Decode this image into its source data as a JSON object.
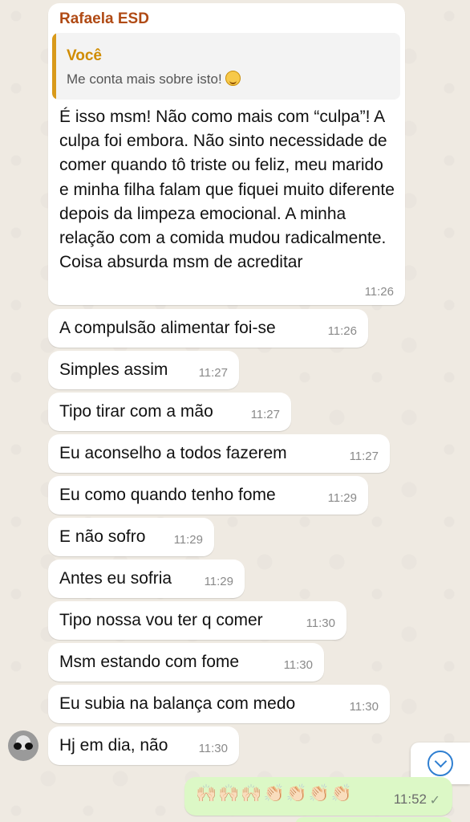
{
  "first_message": {
    "sender": "Rafaela ESD",
    "quote_author": "Você",
    "quote_text": "Me conta mais sobre isto!",
    "quote_emoji": "star-struck-emoji",
    "body": "É isso msm! Não como mais com “culpa”! A culpa foi embora. Não sinto necessidade de comer quando tô triste ou feliz, meu marido e minha filha falam que fiquei muito diferente depois da limpeza emocional. A minha relação com a comida mudou radicalmente. Coisa absurda msm de acreditar",
    "time": "11:26"
  },
  "messages": [
    {
      "text": "A compulsão alimentar foi-se",
      "time": "11:26"
    },
    {
      "text": "Simples assim",
      "time": "11:27"
    },
    {
      "text": "Tipo tirar com a mão",
      "time": "11:27"
    },
    {
      "text": "Eu aconselho a todos fazerem",
      "time": "11:27"
    },
    {
      "text": "Eu como quando tenho fome",
      "time": "11:29"
    },
    {
      "text": "E não sofro",
      "time": "11:29"
    },
    {
      "text": "Antes eu sofria",
      "time": "11:29"
    },
    {
      "text": "Tipo nossa vou ter q comer",
      "time": "11:30"
    },
    {
      "text": "Msm estando com fome",
      "time": "11:30"
    },
    {
      "text": "Eu subia na balança com medo",
      "time": "11:30"
    },
    {
      "text": "Hj em dia, não",
      "time": "11:30"
    }
  ],
  "outgoing": {
    "emojis": "🙌🏻🙌🏻🙌🏻👏🏻👏🏻👏🏻👏🏻",
    "time": "11:52",
    "status_icon": "delivered-check-icon"
  },
  "scroll_button_icon": "chevron-down-circle-icon",
  "colors": {
    "sender_name": "#b04a14",
    "quote_author": "#d08c00",
    "outgoing_bubble": "#dcf8c6",
    "incoming_bubble": "#ffffff"
  }
}
